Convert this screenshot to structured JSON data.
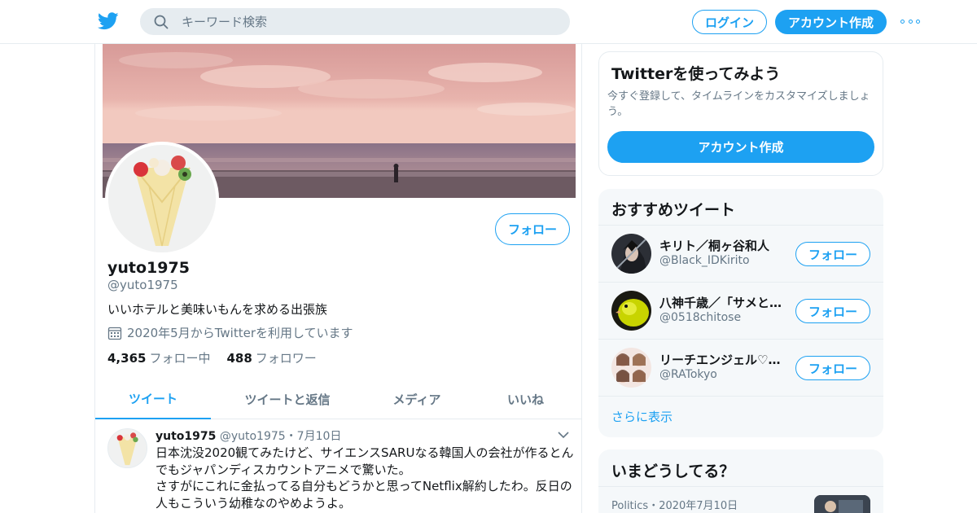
{
  "colors": {
    "accent": "#1da1f2",
    "text": "#14171a",
    "muted": "#657786",
    "border": "#e6ecf0",
    "panel": "#f5f8fa"
  },
  "header": {
    "logo_icon": "twitter-bird-icon",
    "search": {
      "placeholder": "キーワード検索",
      "icon": "search-icon"
    },
    "login_label": "ログイン",
    "signup_label": "アカウント作成",
    "more_icon": "more-dots-icon"
  },
  "profile": {
    "display_name": "yuto1975",
    "handle": "@yuto1975",
    "bio": "いいホテルと美味いもんを求める出張族",
    "joined": "2020年5月からTwitterを利用しています",
    "following_count": "4,365",
    "following_label": "フォロー中",
    "followers_count": "488",
    "followers_label": "フォロワー",
    "follow_label": "フォロー"
  },
  "tabs": [
    {
      "label": "ツイート",
      "active": true
    },
    {
      "label": "ツイートと返信",
      "active": false
    },
    {
      "label": "メディア",
      "active": false
    },
    {
      "label": "いいね",
      "active": false
    }
  ],
  "tweet": {
    "name": "yuto1975",
    "handle": "@yuto1975",
    "separator": "・",
    "date": "7月10日",
    "line1": "日本沈没2020観てみたけど、サイエンスSARUなる韓国人の会社が作るとん",
    "line2": "でもジャパンディスカウントアニメで驚いた。",
    "line3": "さすがにこれに金払ってる自分もどうかと思ってNetflix解約したわ。反日の",
    "line4": "人もこういう幼稚なのやめようよ。"
  },
  "signup_card": {
    "title": "Twitterを使ってみよう",
    "description": "今すぐ登録して、タイムラインをカスタマイズしましょう。",
    "button_label": "アカウント作成"
  },
  "suggestions": {
    "title": "おすすめツイート",
    "items": [
      {
        "name": "キリト／桐ヶ谷和人",
        "handle": "@Black_IDKirito",
        "follow_label": "フォロー"
      },
      {
        "name": "八神千歳／「サメと…",
        "handle": "@0518chitose",
        "follow_label": "フォロー"
      },
      {
        "name": "リーチエンジェル♡…",
        "handle": "@RATokyo",
        "follow_label": "フォロー"
      }
    ],
    "more_label": "さらに表示"
  },
  "trends": {
    "title": "いまどうしてる？",
    "category": "Politics",
    "separator": "・",
    "date": "2020年7月10日"
  }
}
